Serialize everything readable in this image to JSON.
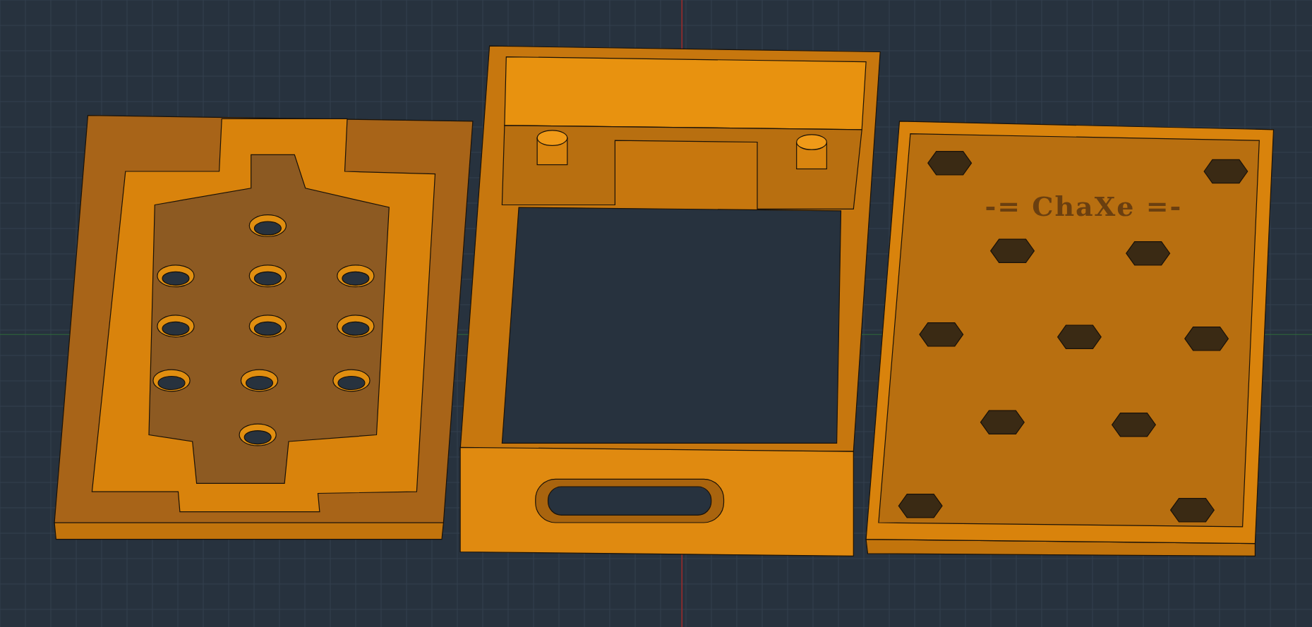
{
  "viewport": {
    "engraved_text": "-= ChaXe =-"
  }
}
